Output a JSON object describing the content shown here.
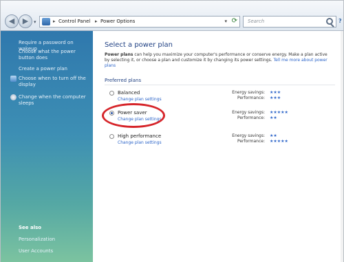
{
  "address_bar": {
    "crumbs": [
      "Control Panel",
      "Power Options"
    ],
    "search_placeholder": "Search"
  },
  "left_pane": {
    "tasks": [
      "Require a password on wakeup",
      "Choose what the power button does",
      "Create a power plan",
      "Choose when to turn off the display",
      "Change when the computer sleeps"
    ],
    "see_also_title": "See also",
    "see_also_items": [
      "Personalization",
      "User Accounts"
    ]
  },
  "main": {
    "title": "Select a power plan",
    "description_bold": "Power plans",
    "description": " can help you maximize your computer's performance or conserve energy. Make a plan active by selecting it, or choose a plan and customize it by changing its power settings.",
    "tell_me_link": "Tell me more about power plans",
    "preferred_label": "Preferred plans",
    "energy_label": "Energy savings:",
    "performance_label": "Performance:",
    "plans": [
      {
        "name": "Balanced",
        "link": "Change plan settings",
        "selected": false,
        "energy": "★★★",
        "performance": "★★★"
      },
      {
        "name": "Power saver",
        "link": "Change plan settings",
        "selected": true,
        "energy": "★★★★★",
        "performance": "★★"
      },
      {
        "name": "High performance",
        "link": "Change plan settings",
        "selected": false,
        "energy": "★★",
        "performance": "★★★★★"
      }
    ]
  },
  "colors": {
    "annotation": "#d6252a",
    "link": "#2a63c8",
    "title": "#1e3f82"
  }
}
